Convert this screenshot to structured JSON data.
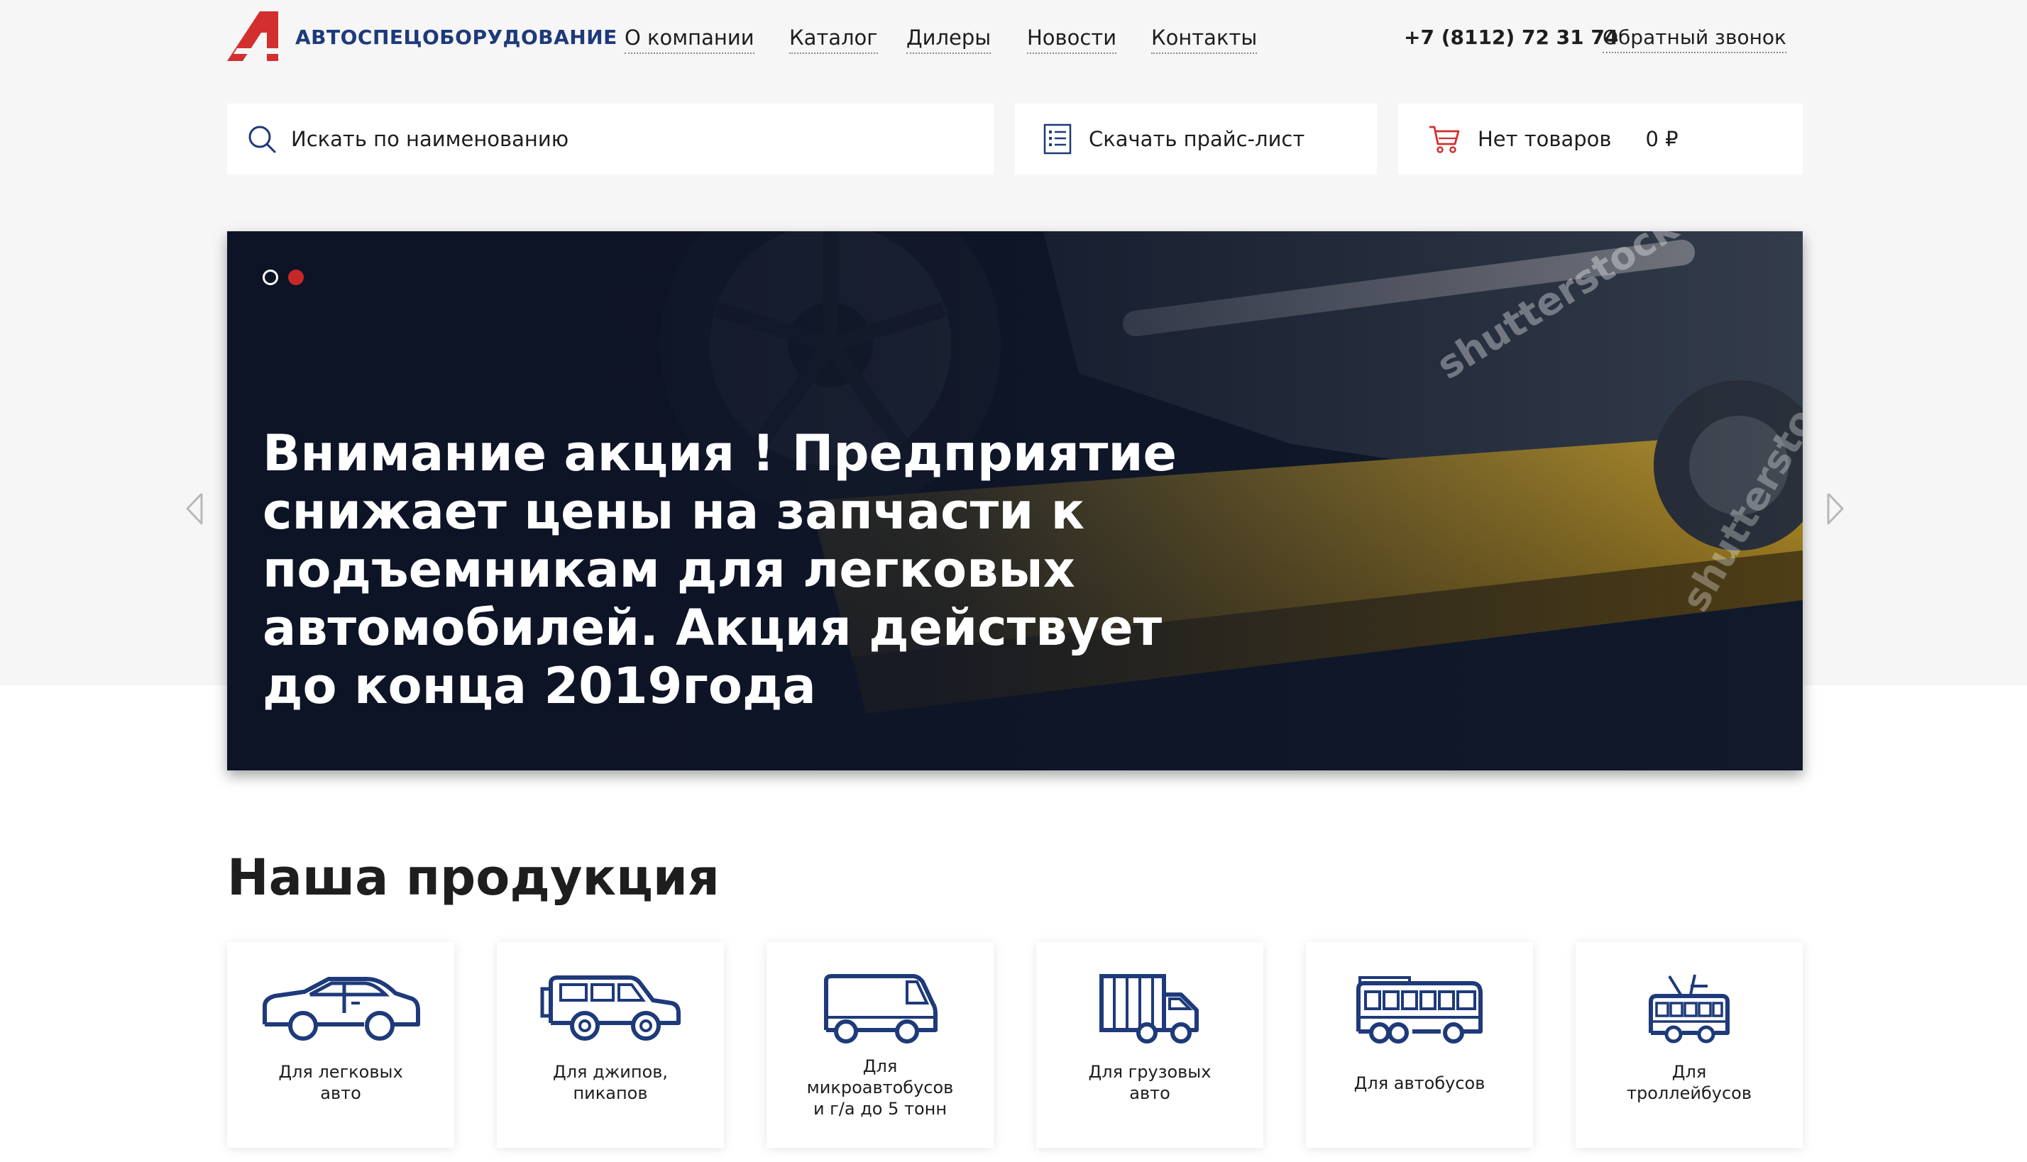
{
  "header": {
    "brand": "АВТОСПЕЦОБОРУДОВАНИЕ",
    "nav": [
      "О компании",
      "Каталог",
      "Дилеры",
      "Новости",
      "Контакты"
    ],
    "phone": "+7 (8112) 72 31 74",
    "callback": "Обратный звонок"
  },
  "toolbar": {
    "search_placeholder": "Искать по наименованию",
    "price_list": "Скачать прайс-лист",
    "cart_label": "Нет товаров",
    "cart_sum": "0 ₽"
  },
  "slider": {
    "title": "Внимание акция ! Предприятие снижает цены на запчасти к подъемникам для легковых автомобилей. Акция действует до конца 2019года",
    "watermark": "shutterstock",
    "active_slide": 2,
    "slide_count": 2
  },
  "products": {
    "title": "Наша продукция",
    "items": [
      {
        "label": "Для легковых\nавто",
        "icon": "car-icon"
      },
      {
        "label": "Для джипов,\nпикапов",
        "icon": "jeep-icon"
      },
      {
        "label": "Для\nмикроавтобусов\nи г/а до 5 тонн",
        "icon": "van-icon"
      },
      {
        "label": "Для грузовых\nавто",
        "icon": "truck-icon"
      },
      {
        "label": "Для автобусов",
        "icon": "bus-icon"
      },
      {
        "label": "Для\nтроллейбусов",
        "icon": "trolleybus-icon"
      }
    ]
  },
  "colors": {
    "brand_blue": "#1e3a7a",
    "accent_red": "#d32f2f",
    "page_bg": "#f6f6f6"
  }
}
